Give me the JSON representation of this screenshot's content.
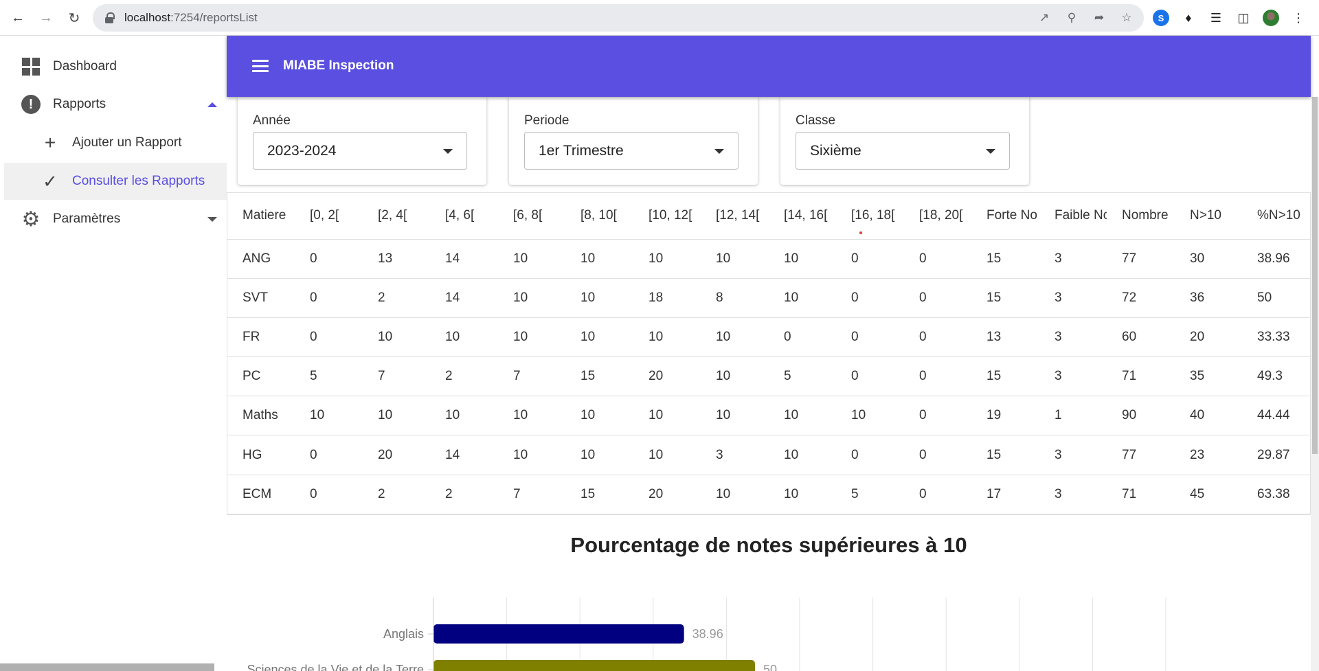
{
  "browser": {
    "url_host": "localhost",
    "url_rest": ":7254/reportsList",
    "icons": [
      "back-icon",
      "forward-icon",
      "reload-icon",
      "lock-icon",
      "open-external-icon",
      "zoom-icon",
      "share-icon",
      "star-icon",
      "extension-icon",
      "puzzle-icon",
      "media-icon",
      "sidepanel-icon",
      "profile-avatar",
      "menu-icon"
    ]
  },
  "sidebar": {
    "items": [
      {
        "label": "Dashboard"
      },
      {
        "label": "Rapports"
      },
      {
        "label": "Ajouter un Rapport"
      },
      {
        "label": "Consulter les Rapports"
      },
      {
        "label": "Paramètres"
      }
    ]
  },
  "appbar": {
    "title": "MIABE Inspection"
  },
  "filters": {
    "annee": {
      "label": "Année",
      "value": "2023-2024"
    },
    "periode": {
      "label": "Periode",
      "value": "1er Trimestre"
    },
    "classe": {
      "label": "Classe",
      "value": "Sixième"
    }
  },
  "table": {
    "headers": [
      "Matiere",
      "[0, 2[",
      "[2, 4[",
      "[4, 6[",
      "[6, 8[",
      "[8, 10[",
      "[10, 12[",
      "[12, 14[",
      "[14, 16[",
      "[16, 18[",
      "[18, 20[",
      "Forte No",
      "Faible No",
      "Nombre",
      "N>10",
      "%N>10"
    ],
    "rows": [
      [
        "ANG",
        "0",
        "13",
        "14",
        "10",
        "10",
        "10",
        "10",
        "10",
        "0",
        "0",
        "15",
        "3",
        "77",
        "30",
        "38.96"
      ],
      [
        "SVT",
        "0",
        "2",
        "14",
        "10",
        "10",
        "18",
        "8",
        "10",
        "0",
        "0",
        "15",
        "3",
        "72",
        "36",
        "50"
      ],
      [
        "FR",
        "0",
        "10",
        "10",
        "10",
        "10",
        "10",
        "10",
        "0",
        "0",
        "0",
        "13",
        "3",
        "60",
        "20",
        "33.33"
      ],
      [
        "PC",
        "5",
        "7",
        "2",
        "7",
        "15",
        "20",
        "10",
        "5",
        "0",
        "0",
        "15",
        "3",
        "71",
        "35",
        "49.3"
      ],
      [
        "Maths",
        "10",
        "10",
        "10",
        "10",
        "10",
        "10",
        "10",
        "10",
        "10",
        "0",
        "19",
        "1",
        "90",
        "40",
        "44.44"
      ],
      [
        "HG",
        "0",
        "20",
        "14",
        "10",
        "10",
        "10",
        "3",
        "10",
        "0",
        "0",
        "15",
        "3",
        "77",
        "23",
        "29.87"
      ],
      [
        "ECM",
        "0",
        "2",
        "2",
        "7",
        "15",
        "20",
        "10",
        "10",
        "5",
        "0",
        "17",
        "3",
        "71",
        "45",
        "63.38"
      ]
    ]
  },
  "chart_data": {
    "type": "bar",
    "orientation": "horizontal",
    "title": "Pourcentage de notes supérieures à 10",
    "categories": [
      "Anglais",
      "Sciences de la Vie et de la Terre"
    ],
    "values": [
      38.96,
      50
    ],
    "colors": [
      "#000080",
      "#808000"
    ],
    "xlim": [
      0,
      100
    ],
    "grid": true
  }
}
